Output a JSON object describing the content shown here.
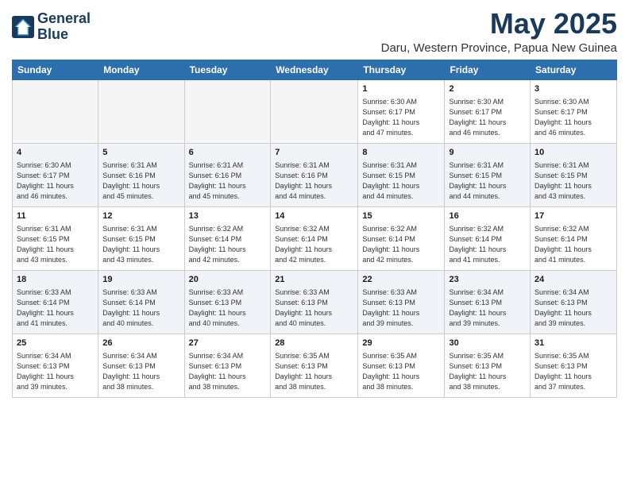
{
  "logo": {
    "line1": "General",
    "line2": "Blue"
  },
  "title": "May 2025",
  "location": "Daru, Western Province, Papua New Guinea",
  "weekdays": [
    "Sunday",
    "Monday",
    "Tuesday",
    "Wednesday",
    "Thursday",
    "Friday",
    "Saturday"
  ],
  "weeks": [
    [
      {
        "day": "",
        "info": ""
      },
      {
        "day": "",
        "info": ""
      },
      {
        "day": "",
        "info": ""
      },
      {
        "day": "",
        "info": ""
      },
      {
        "day": "1",
        "info": "Sunrise: 6:30 AM\nSunset: 6:17 PM\nDaylight: 11 hours\nand 47 minutes."
      },
      {
        "day": "2",
        "info": "Sunrise: 6:30 AM\nSunset: 6:17 PM\nDaylight: 11 hours\nand 46 minutes."
      },
      {
        "day": "3",
        "info": "Sunrise: 6:30 AM\nSunset: 6:17 PM\nDaylight: 11 hours\nand 46 minutes."
      }
    ],
    [
      {
        "day": "4",
        "info": "Sunrise: 6:30 AM\nSunset: 6:17 PM\nDaylight: 11 hours\nand 46 minutes."
      },
      {
        "day": "5",
        "info": "Sunrise: 6:31 AM\nSunset: 6:16 PM\nDaylight: 11 hours\nand 45 minutes."
      },
      {
        "day": "6",
        "info": "Sunrise: 6:31 AM\nSunset: 6:16 PM\nDaylight: 11 hours\nand 45 minutes."
      },
      {
        "day": "7",
        "info": "Sunrise: 6:31 AM\nSunset: 6:16 PM\nDaylight: 11 hours\nand 44 minutes."
      },
      {
        "day": "8",
        "info": "Sunrise: 6:31 AM\nSunset: 6:15 PM\nDaylight: 11 hours\nand 44 minutes."
      },
      {
        "day": "9",
        "info": "Sunrise: 6:31 AM\nSunset: 6:15 PM\nDaylight: 11 hours\nand 44 minutes."
      },
      {
        "day": "10",
        "info": "Sunrise: 6:31 AM\nSunset: 6:15 PM\nDaylight: 11 hours\nand 43 minutes."
      }
    ],
    [
      {
        "day": "11",
        "info": "Sunrise: 6:31 AM\nSunset: 6:15 PM\nDaylight: 11 hours\nand 43 minutes."
      },
      {
        "day": "12",
        "info": "Sunrise: 6:31 AM\nSunset: 6:15 PM\nDaylight: 11 hours\nand 43 minutes."
      },
      {
        "day": "13",
        "info": "Sunrise: 6:32 AM\nSunset: 6:14 PM\nDaylight: 11 hours\nand 42 minutes."
      },
      {
        "day": "14",
        "info": "Sunrise: 6:32 AM\nSunset: 6:14 PM\nDaylight: 11 hours\nand 42 minutes."
      },
      {
        "day": "15",
        "info": "Sunrise: 6:32 AM\nSunset: 6:14 PM\nDaylight: 11 hours\nand 42 minutes."
      },
      {
        "day": "16",
        "info": "Sunrise: 6:32 AM\nSunset: 6:14 PM\nDaylight: 11 hours\nand 41 minutes."
      },
      {
        "day": "17",
        "info": "Sunrise: 6:32 AM\nSunset: 6:14 PM\nDaylight: 11 hours\nand 41 minutes."
      }
    ],
    [
      {
        "day": "18",
        "info": "Sunrise: 6:33 AM\nSunset: 6:14 PM\nDaylight: 11 hours\nand 41 minutes."
      },
      {
        "day": "19",
        "info": "Sunrise: 6:33 AM\nSunset: 6:14 PM\nDaylight: 11 hours\nand 40 minutes."
      },
      {
        "day": "20",
        "info": "Sunrise: 6:33 AM\nSunset: 6:13 PM\nDaylight: 11 hours\nand 40 minutes."
      },
      {
        "day": "21",
        "info": "Sunrise: 6:33 AM\nSunset: 6:13 PM\nDaylight: 11 hours\nand 40 minutes."
      },
      {
        "day": "22",
        "info": "Sunrise: 6:33 AM\nSunset: 6:13 PM\nDaylight: 11 hours\nand 39 minutes."
      },
      {
        "day": "23",
        "info": "Sunrise: 6:34 AM\nSunset: 6:13 PM\nDaylight: 11 hours\nand 39 minutes."
      },
      {
        "day": "24",
        "info": "Sunrise: 6:34 AM\nSunset: 6:13 PM\nDaylight: 11 hours\nand 39 minutes."
      }
    ],
    [
      {
        "day": "25",
        "info": "Sunrise: 6:34 AM\nSunset: 6:13 PM\nDaylight: 11 hours\nand 39 minutes."
      },
      {
        "day": "26",
        "info": "Sunrise: 6:34 AM\nSunset: 6:13 PM\nDaylight: 11 hours\nand 38 minutes."
      },
      {
        "day": "27",
        "info": "Sunrise: 6:34 AM\nSunset: 6:13 PM\nDaylight: 11 hours\nand 38 minutes."
      },
      {
        "day": "28",
        "info": "Sunrise: 6:35 AM\nSunset: 6:13 PM\nDaylight: 11 hours\nand 38 minutes."
      },
      {
        "day": "29",
        "info": "Sunrise: 6:35 AM\nSunset: 6:13 PM\nDaylight: 11 hours\nand 38 minutes."
      },
      {
        "day": "30",
        "info": "Sunrise: 6:35 AM\nSunset: 6:13 PM\nDaylight: 11 hours\nand 38 minutes."
      },
      {
        "day": "31",
        "info": "Sunrise: 6:35 AM\nSunset: 6:13 PM\nDaylight: 11 hours\nand 37 minutes."
      }
    ]
  ]
}
